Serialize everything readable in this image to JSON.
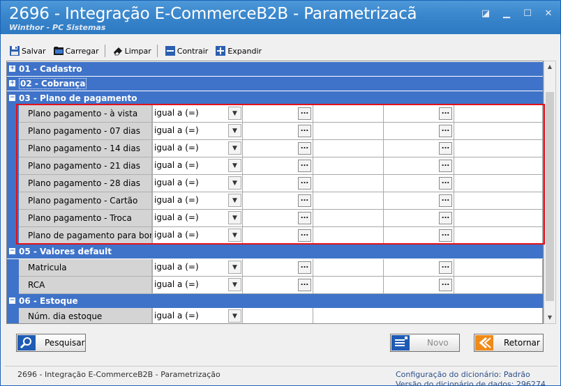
{
  "window": {
    "title": "2696 - Integração E-CommerceB2B - Parametrizacã",
    "subtitle": "Winthor - PC Sistemas",
    "controls": [
      "restore",
      "minimize",
      "maximize",
      "close"
    ]
  },
  "toolbar": {
    "save_label": "Salvar",
    "load_label": "Carregar",
    "clear_label": "Limpar",
    "collapse_label": "Contrair",
    "expand_label": "Expandir"
  },
  "sections": {
    "s01": "01 - Cadastro",
    "s02": "02 - Cobrança",
    "s03": "03 - Plano de pagamento",
    "s05": "05 - Valores default",
    "s06": "06 - Estoque"
  },
  "rows": {
    "r0": {
      "label": "Plano pagamento - à vista",
      "op": "igual a (=)"
    },
    "r1": {
      "label": "Plano pagamento - 07 dias",
      "op": "igual a (=)"
    },
    "r2": {
      "label": "Plano pagamento - 14 dias",
      "op": "igual a (=)"
    },
    "r3": {
      "label": "Plano pagamento - 21 dias",
      "op": "igual a (=)"
    },
    "r4": {
      "label": "Plano pagamento - 28 dias",
      "op": "igual a (=)"
    },
    "r5": {
      "label": "Plano pagamento - Cartão",
      "op": "igual a (=)"
    },
    "r6": {
      "label": "Plano pagamento - Troca",
      "op": "igual a (=)"
    },
    "r7": {
      "label": "Plano de pagamento para boni",
      "op": "igual a (=)"
    },
    "r8": {
      "label": "Matricula",
      "op": "igual a (=)"
    },
    "r9": {
      "label": "RCA",
      "op": "igual a (=)"
    },
    "r10": {
      "label": "Núm. dia estoque",
      "op": "igual a (=)"
    }
  },
  "ellipsis": "...",
  "buttons": {
    "search": "Pesquisar",
    "new": "Novo",
    "back": "Retornar"
  },
  "status": {
    "left": "2696 - Integração E-CommerceB2B - Parametrização",
    "dict_config_label": "Configuração do dicionário:",
    "dict_config_value": "Padrão",
    "dict_version_label": "Versão do dicionário de dados:",
    "dict_version_value": "296274"
  },
  "colors": {
    "title_blue": "#3a86cc",
    "section_blue": "#3f73c9",
    "highlight_red": "#e3101c"
  }
}
